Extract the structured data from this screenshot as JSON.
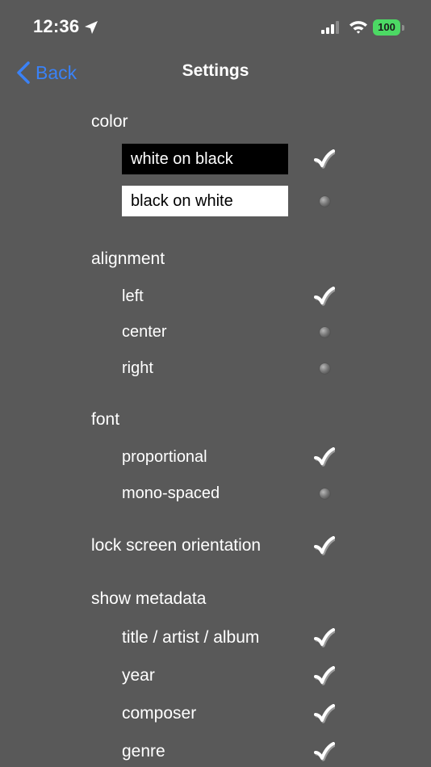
{
  "status_bar": {
    "time": "12:36",
    "battery": "100"
  },
  "nav": {
    "back_label": "Back",
    "title": "Settings"
  },
  "sections": {
    "color": {
      "title": "color",
      "options": [
        {
          "label": "white on black",
          "selected": true
        },
        {
          "label": "black on white",
          "selected": false
        }
      ]
    },
    "alignment": {
      "title": "alignment",
      "options": [
        {
          "label": "left",
          "selected": true
        },
        {
          "label": "center",
          "selected": false
        },
        {
          "label": "right",
          "selected": false
        }
      ]
    },
    "font": {
      "title": "font",
      "options": [
        {
          "label": "proportional",
          "selected": true
        },
        {
          "label": "mono-spaced",
          "selected": false
        }
      ]
    },
    "lock_orientation": {
      "label": "lock screen orientation",
      "checked": true
    },
    "metadata": {
      "title": "show metadata",
      "options": [
        {
          "label": "title / artist / album",
          "checked": true
        },
        {
          "label": "year",
          "checked": true
        },
        {
          "label": "composer",
          "checked": true
        },
        {
          "label": "genre",
          "checked": true
        }
      ]
    }
  },
  "colors": {
    "background": "#595959",
    "accent": "#3a82f7",
    "battery": "#4cd964"
  }
}
